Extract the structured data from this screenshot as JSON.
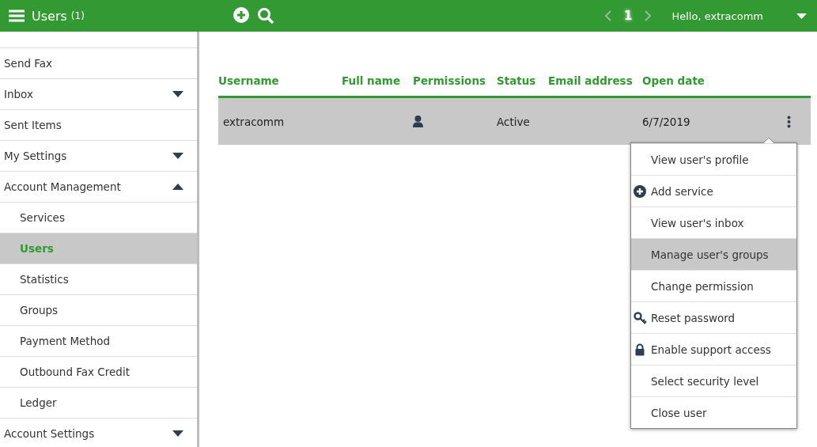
{
  "header": {
    "title": "Users",
    "count": "(1)",
    "page": "1",
    "prev_disabled": true,
    "next_disabled": true,
    "greeting": "Hello, extracomm"
  },
  "sidebar": {
    "items": [
      {
        "label": "Send Fax",
        "kind": "link",
        "selected": false
      },
      {
        "label": "Inbox",
        "kind": "group",
        "expanded": false,
        "selected": false
      },
      {
        "label": "Sent Items",
        "kind": "link",
        "selected": false
      },
      {
        "label": "My Settings",
        "kind": "group",
        "expanded": false,
        "selected": false
      },
      {
        "label": "Account Management",
        "kind": "group",
        "expanded": true,
        "selected": false,
        "children": [
          {
            "label": "Services",
            "selected": false
          },
          {
            "label": "Users",
            "selected": true
          },
          {
            "label": "Statistics",
            "selected": false
          },
          {
            "label": "Groups",
            "selected": false
          },
          {
            "label": "Payment Method",
            "selected": false
          },
          {
            "label": "Outbound Fax Credit",
            "selected": false
          },
          {
            "label": "Ledger",
            "selected": false
          }
        ]
      },
      {
        "label": "Account Settings",
        "kind": "group",
        "expanded": false,
        "selected": false
      }
    ]
  },
  "table": {
    "columns": [
      "Username",
      "Full name",
      "Permissions",
      "Status",
      "Email address",
      "Open date"
    ],
    "rows": [
      {
        "username": "extracomm",
        "status": "Active",
        "open_date": "6/7/2019",
        "selected": true
      }
    ]
  },
  "row_menu": {
    "items": [
      {
        "label": "View user's profile",
        "kind": "plain",
        "selected": false
      },
      {
        "label": "Add service",
        "kind": "add",
        "selected": false
      },
      {
        "label": "View user's inbox",
        "kind": "plain",
        "selected": false
      },
      {
        "label": "Manage user's groups",
        "kind": "plain",
        "selected": true
      },
      {
        "label": "Change permission",
        "kind": "plain",
        "selected": false
      },
      {
        "label": "Reset password",
        "kind": "key",
        "selected": false
      },
      {
        "label": "Enable support access",
        "kind": "lock",
        "selected": false
      },
      {
        "label": "Select security level",
        "kind": "plain",
        "selected": false
      },
      {
        "label": "Close user",
        "kind": "plain",
        "selected": false
      }
    ]
  }
}
